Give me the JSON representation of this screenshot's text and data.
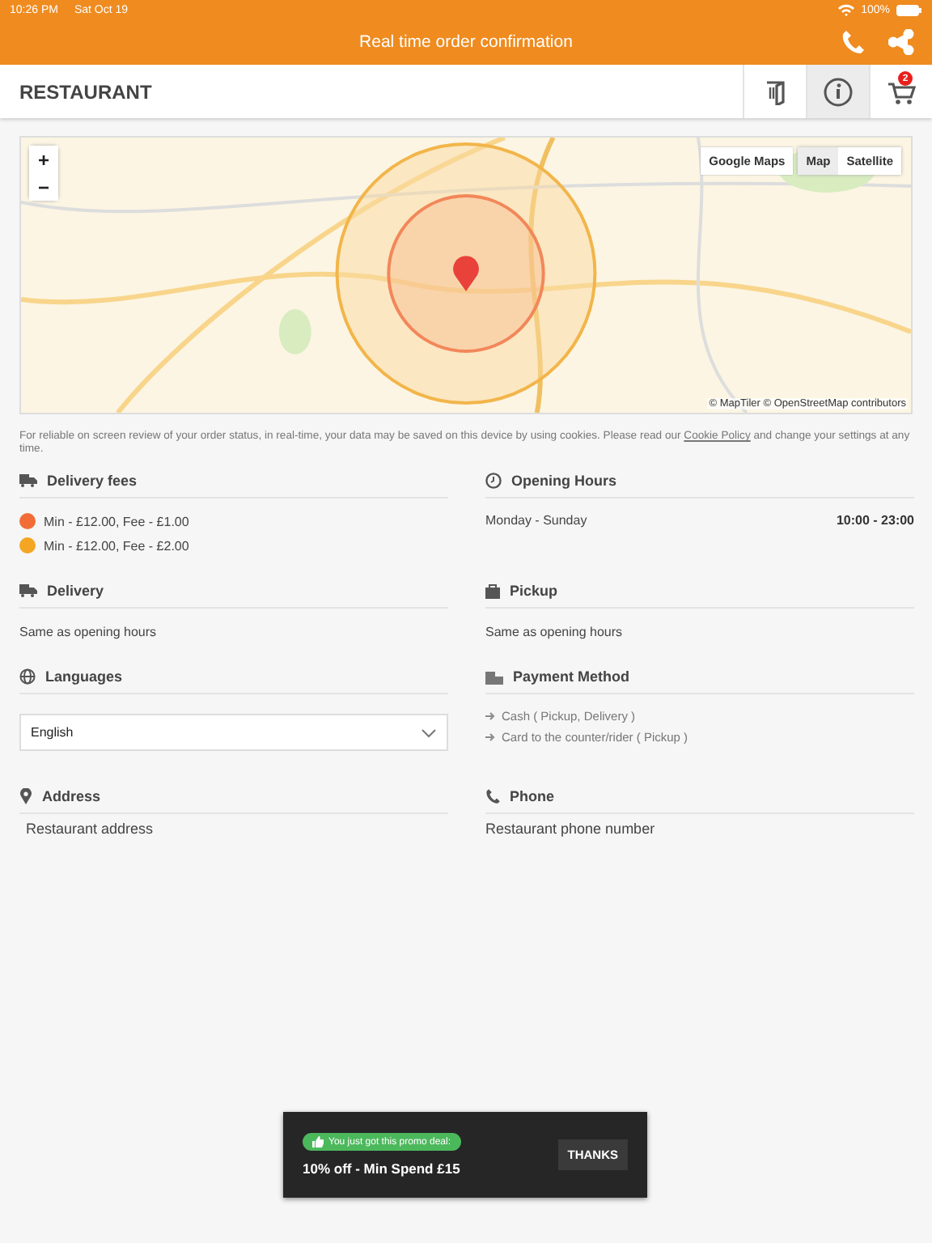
{
  "status_bar": {
    "time": "10:26 PM",
    "date": "Sat Oct 19",
    "battery": "100%"
  },
  "header": {
    "title": "Real time order confirmation"
  },
  "toolbar": {
    "title": "RESTAURANT",
    "cart_count": "2",
    "buttons": [
      {
        "kind": "menu",
        "selected": false
      },
      {
        "kind": "info",
        "selected": true
      },
      {
        "kind": "cart",
        "selected": false
      }
    ]
  },
  "map": {
    "zoom_in": "+",
    "zoom_out": "−",
    "google_maps": "Google Maps",
    "types": [
      {
        "label": "Map",
        "selected": true
      },
      {
        "label": "Satellite",
        "selected": false
      }
    ],
    "attribution": "© MapTiler © OpenStreetMap contributors"
  },
  "cookie_notice": {
    "before": "For reliable on screen review of your order status, in real-time, your data may be saved on this device by using cookies. Please read our ",
    "link": "Cookie Policy",
    "after": " and change your settings at any time."
  },
  "delivery_fees": {
    "title": "Delivery fees",
    "items": [
      {
        "text": "Min - £12.00, Fee - £1.00",
        "color": "#f26d35"
      },
      {
        "text": "Min - £12.00, Fee - £2.00",
        "color": "#f4a623"
      }
    ]
  },
  "opening_hours": {
    "title": "Opening Hours",
    "rows": [
      {
        "days": "Monday - Sunday",
        "hours": "10:00 - 23:00"
      }
    ]
  },
  "delivery": {
    "title": "Delivery",
    "text": "Same as opening hours"
  },
  "pickup": {
    "title": "Pickup",
    "text": "Same as opening hours"
  },
  "languages": {
    "title": "Languages",
    "value": "English"
  },
  "payment_method": {
    "title": "Payment Method",
    "items": [
      "Cash ( Pickup, Delivery )",
      "Card to the counter/rider ( Pickup )"
    ]
  },
  "address": {
    "title": "Address",
    "text": "Restaurant address"
  },
  "phone": {
    "title": "Phone",
    "text": "Restaurant phone number"
  },
  "promo": {
    "badge": "You just got this promo deal:",
    "text": "10% off - Min Spend £15",
    "button": "THANKS"
  }
}
